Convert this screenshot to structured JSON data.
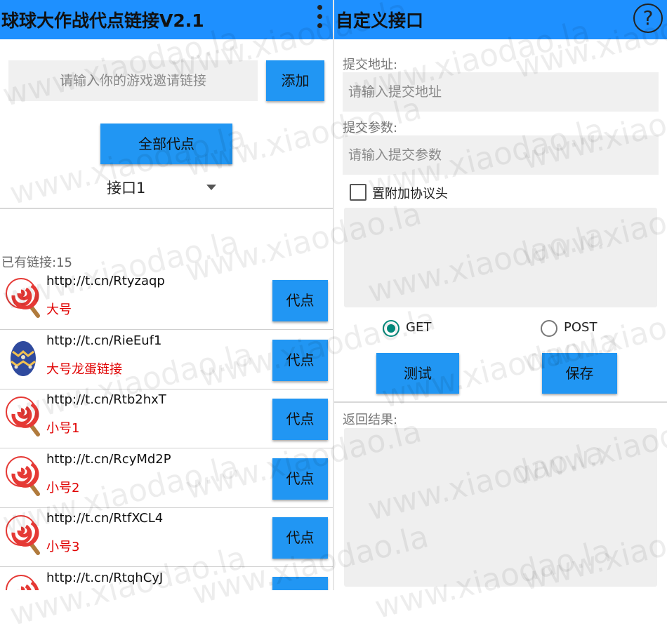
{
  "left": {
    "title": "球球大作战代点链接V2.1",
    "invite_placeholder": "请输入你的游戏邀请链接",
    "add_label": "添加",
    "all_label": "全部代点",
    "interface_value": "接口1",
    "count_text": "已有链接:15",
    "rows": [
      {
        "url": "http://t.cn/Rtyzaqp",
        "name": "大号",
        "icon": "lollipop-icon",
        "button": "代点"
      },
      {
        "url": "http://t.cn/RieEuf1",
        "name": "大号龙蛋链接",
        "icon": "dragon-egg-icon",
        "button": "代点"
      },
      {
        "url": "http://t.cn/Rtb2hxT",
        "name": "小号1",
        "icon": "lollipop-icon",
        "button": "代点"
      },
      {
        "url": "http://t.cn/RcyMd2P",
        "name": "小号2",
        "icon": "lollipop-icon",
        "button": "代点"
      },
      {
        "url": "http://t.cn/RtfXCL4",
        "name": "小号3",
        "icon": "lollipop-icon",
        "button": "代点"
      },
      {
        "url": "http://t.cn/RtqhCyJ",
        "name": "",
        "icon": "lollipop-icon",
        "button": ""
      }
    ]
  },
  "right": {
    "title": "自定义接口",
    "url_label": "提交地址:",
    "url_placeholder": "请输入提交地址",
    "param_label": "提交参数:",
    "param_placeholder": "请输入提交参数",
    "checkbox_label": "置附加协议头",
    "checkbox_checked": false,
    "method_get": "GET",
    "method_post": "POST",
    "selected_method": "GET",
    "test_label": "测试",
    "save_label": "保存",
    "result_label": "返回结果:"
  },
  "watermark": "www.xiaodao.la",
  "colors": {
    "appbar": "#1e90ff",
    "button": "#2196f3",
    "alias": "#e00000",
    "radio_on": "#00897b"
  }
}
